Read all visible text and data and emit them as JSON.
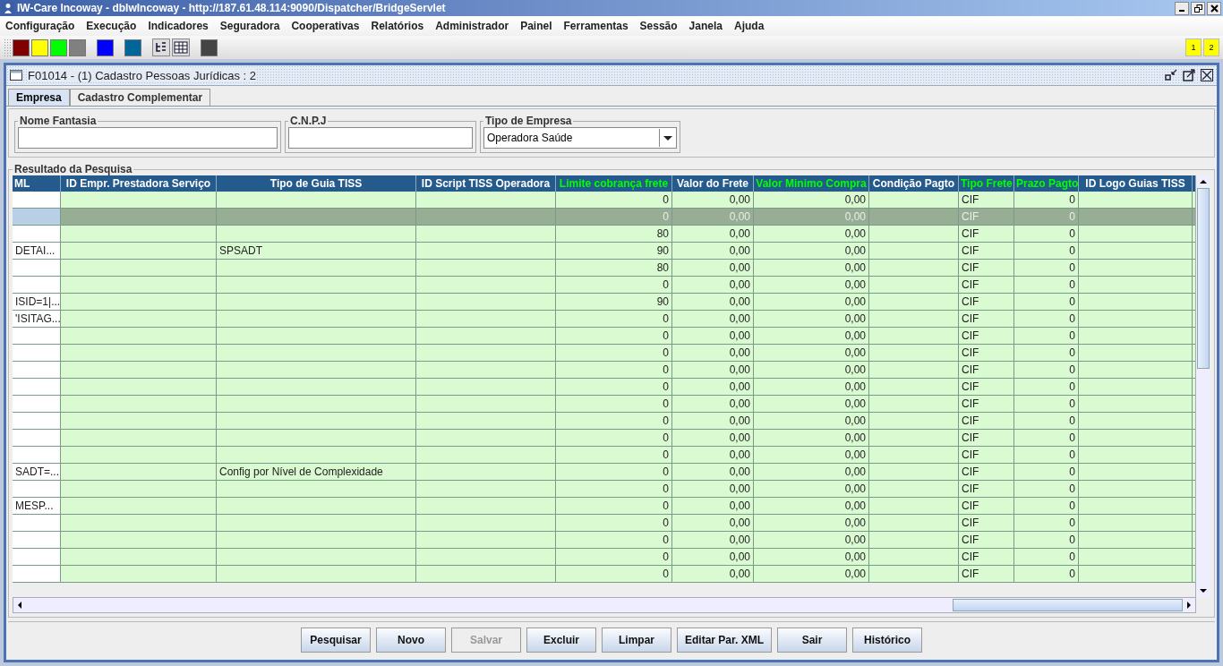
{
  "window": {
    "title": "IW-Care Incoway - dbIwIncoway - http://187.61.48.114:9090/Dispatcher/BridgeServlet"
  },
  "menu": [
    "Configuração",
    "Execução",
    "Indicadores",
    "Seguradora",
    "Cooperativas",
    "Relatórios",
    "Administrador",
    "Painel",
    "Ferramentas",
    "Sessão",
    "Janela",
    "Ajuda"
  ],
  "toolbar": {
    "color_buttons": [
      {
        "color": "#800000"
      },
      {
        "color": "#ffff00"
      },
      {
        "color": "#00ff00"
      },
      {
        "color": "#808080"
      },
      {
        "color": "#0000ff"
      },
      {
        "color": "#006699"
      }
    ],
    "desktop_buttons": [
      "1",
      "2"
    ]
  },
  "frame": {
    "title": "F01014 - (1) Cadastro Pessoas Jurídicas : 2",
    "tabs": [
      {
        "label": "Empresa",
        "selected": true
      },
      {
        "label": "Cadastro Complementar",
        "selected": false
      }
    ],
    "fields": [
      {
        "label": "Nome Fantasia",
        "kind": "text"
      },
      {
        "label": "C.N.P.J",
        "kind": "text"
      },
      {
        "label": "Tipo de Empresa",
        "kind": "select",
        "value": "Operadora Saúde"
      }
    ],
    "results": {
      "title": "Resultado da Pesquisa",
      "columns": [
        {
          "label": "ML",
          "highlighted": false
        },
        {
          "label": "ID Empr. Prestadora Serviço",
          "highlighted": false
        },
        {
          "label": "Tipo de Guia TISS",
          "highlighted": false
        },
        {
          "label": "ID Script TISS Operadora",
          "highlighted": false
        },
        {
          "label": "Limite cobrança frete",
          "highlighted": true
        },
        {
          "label": "Valor do Frete",
          "highlighted": false
        },
        {
          "label": "Valor Minimo Compra",
          "highlighted": true
        },
        {
          "label": "Condição Pagto",
          "highlighted": false
        },
        {
          "label": "Tipo Frete",
          "highlighted": true
        },
        {
          "label": "Prazo Pagto",
          "highlighted": true
        },
        {
          "label": "ID Logo Guias TISS",
          "highlighted": false
        }
      ],
      "rows": [
        {
          "selected": false,
          "cells": [
            null,
            null,
            null,
            null,
            "0",
            "0,00",
            "0,00",
            null,
            "CIF",
            "0",
            null
          ]
        },
        {
          "selected": true,
          "cells": [
            null,
            null,
            null,
            null,
            "0",
            "0,00",
            "0,00",
            null,
            "CIF",
            "0",
            null
          ]
        },
        {
          "selected": false,
          "cells": [
            null,
            null,
            null,
            null,
            "80",
            "0,00",
            "0,00",
            null,
            "CIF",
            "0",
            null
          ]
        },
        {
          "selected": false,
          "cells": [
            "DETAI...",
            null,
            "SPSADT",
            null,
            "90",
            "0,00",
            "0,00",
            null,
            "CIF",
            "0",
            null
          ]
        },
        {
          "selected": false,
          "cells": [
            null,
            null,
            null,
            null,
            "80",
            "0,00",
            "0,00",
            null,
            "CIF",
            "0",
            null
          ]
        },
        {
          "selected": false,
          "cells": [
            null,
            null,
            null,
            null,
            "0",
            "0,00",
            "0,00",
            null,
            "CIF",
            "0",
            null
          ]
        },
        {
          "selected": false,
          "cells": [
            "ISID=1|...",
            null,
            null,
            null,
            "90",
            "0,00",
            "0,00",
            null,
            "CIF",
            "0",
            null
          ]
        },
        {
          "selected": false,
          "cells": [
            "'ISITAG...",
            null,
            null,
            null,
            "0",
            "0,00",
            "0,00",
            null,
            "CIF",
            "0",
            null
          ]
        },
        {
          "selected": false,
          "cells": [
            null,
            null,
            null,
            null,
            "0",
            "0,00",
            "0,00",
            null,
            "CIF",
            "0",
            null
          ]
        },
        {
          "selected": false,
          "cells": [
            null,
            null,
            null,
            null,
            "0",
            "0,00",
            "0,00",
            null,
            "CIF",
            "0",
            null
          ]
        },
        {
          "selected": false,
          "cells": [
            null,
            null,
            null,
            null,
            "0",
            "0,00",
            "0,00",
            null,
            "CIF",
            "0",
            null
          ]
        },
        {
          "selected": false,
          "cells": [
            null,
            null,
            null,
            null,
            "0",
            "0,00",
            "0,00",
            null,
            "CIF",
            "0",
            null
          ]
        },
        {
          "selected": false,
          "cells": [
            null,
            null,
            null,
            null,
            "0",
            "0,00",
            "0,00",
            null,
            "CIF",
            "0",
            null
          ]
        },
        {
          "selected": false,
          "cells": [
            null,
            null,
            null,
            null,
            "0",
            "0,00",
            "0,00",
            null,
            "CIF",
            "0",
            null
          ]
        },
        {
          "selected": false,
          "cells": [
            null,
            null,
            null,
            null,
            "0",
            "0,00",
            "0,00",
            null,
            "CIF",
            "0",
            null
          ]
        },
        {
          "selected": false,
          "cells": [
            null,
            null,
            null,
            null,
            "0",
            "0,00",
            "0,00",
            null,
            "CIF",
            "0",
            null
          ]
        },
        {
          "selected": false,
          "cells": [
            "SADT=...",
            null,
            "Config por Nível de Complexidade",
            null,
            "0",
            "0,00",
            "0,00",
            null,
            "CIF",
            "0",
            null
          ]
        },
        {
          "selected": false,
          "cells": [
            null,
            null,
            null,
            null,
            "0",
            "0,00",
            "0,00",
            null,
            "CIF",
            "0",
            null
          ]
        },
        {
          "selected": false,
          "cells": [
            "MESP...",
            null,
            null,
            null,
            "0",
            "0,00",
            "0,00",
            null,
            "CIF",
            "0",
            null
          ]
        },
        {
          "selected": false,
          "cells": [
            null,
            null,
            null,
            null,
            "0",
            "0,00",
            "0,00",
            null,
            "CIF",
            "0",
            null
          ]
        },
        {
          "selected": false,
          "cells": [
            null,
            null,
            null,
            null,
            "0",
            "0,00",
            "0,00",
            null,
            "CIF",
            "0",
            null
          ]
        },
        {
          "selected": false,
          "cells": [
            null,
            null,
            null,
            null,
            "0",
            "0,00",
            "0,00",
            null,
            "CIF",
            "0",
            null
          ]
        },
        {
          "selected": false,
          "cells": [
            null,
            null,
            null,
            null,
            "0",
            "0,00",
            "0,00",
            null,
            "CIF",
            "0",
            null
          ]
        }
      ]
    },
    "buttons": [
      {
        "label": "Pesquisar",
        "disabled": false
      },
      {
        "label": "Novo",
        "disabled": false
      },
      {
        "label": "Salvar",
        "disabled": true
      },
      {
        "label": "Excluir",
        "disabled": false
      },
      {
        "label": "Limpar",
        "disabled": false
      },
      {
        "label": "Editar Par. XML",
        "disabled": false
      },
      {
        "label": "Sair",
        "disabled": false
      },
      {
        "label": "Histórico",
        "disabled": false
      }
    ]
  }
}
